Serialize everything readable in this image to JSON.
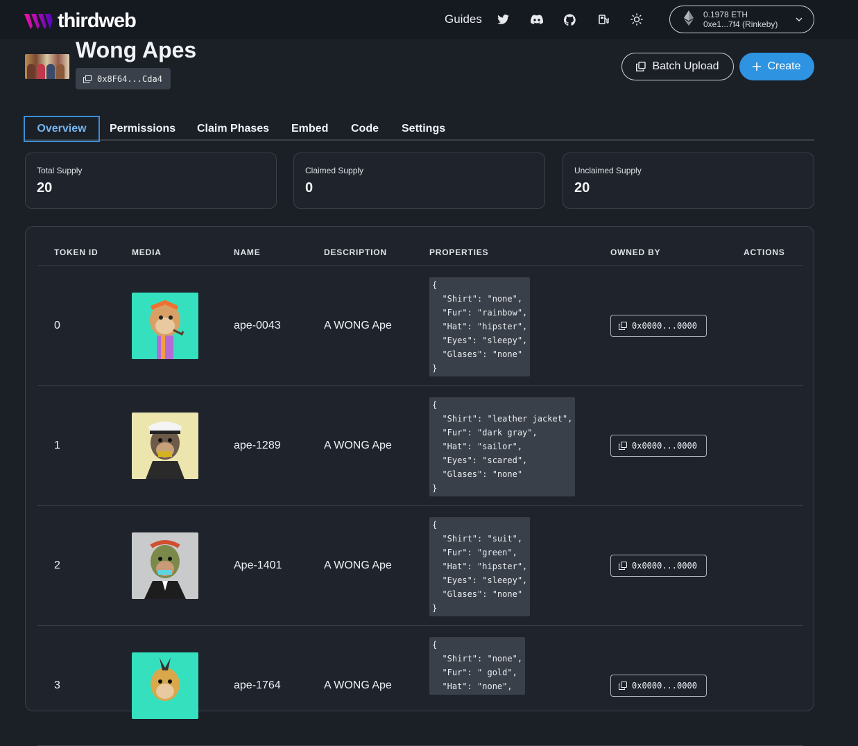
{
  "header": {
    "brand": "thirdweb",
    "nav": {
      "guides": "Guides"
    },
    "wallet": {
      "balance": "0.1978 ETH",
      "address": "0xe1...7f4 (Rinkeby)"
    }
  },
  "collection": {
    "title": "Wong Apes",
    "contract_address": "0x8F64...Cda4",
    "batch_upload_label": "Batch Upload",
    "create_label": "Create"
  },
  "tabs": [
    {
      "label": "Overview",
      "active": true
    },
    {
      "label": "Permissions"
    },
    {
      "label": "Claim Phases"
    },
    {
      "label": "Embed"
    },
    {
      "label": "Code"
    },
    {
      "label": "Settings"
    }
  ],
  "stats": [
    {
      "label": "Total Supply",
      "value": "20"
    },
    {
      "label": "Claimed Supply",
      "value": "0"
    },
    {
      "label": "Unclaimed Supply",
      "value": "20"
    }
  ],
  "table": {
    "columns": [
      "TOKEN ID",
      "MEDIA",
      "NAME",
      "DESCRIPTION",
      "PROPERTIES",
      "OWNED BY",
      "ACTIONS"
    ],
    "rows": [
      {
        "token_id": "0",
        "name": "ape-0043",
        "description": "A WONG Ape",
        "media_bg": "#35e0bf",
        "properties": "{\n  \"Shirt\": \"none\",\n  \"Fur\": \"rainbow\",\n  \"Hat\": \"hipster\",\n  \"Eyes\": \"sleepy\",\n  \"Glases\": \"none\"\n}",
        "owner": "0x0000...0000"
      },
      {
        "token_id": "1",
        "name": "ape-1289",
        "description": "A WONG Ape",
        "media_bg": "#ece6ae",
        "properties": "{\n  \"Shirt\": \"leather jacket\",\n  \"Fur\": \"dark gray\",\n  \"Hat\": \"sailor\",\n  \"Eyes\": \"scared\",\n  \"Glases\": \"none\"\n}",
        "owner": "0x0000...0000"
      },
      {
        "token_id": "2",
        "name": "Ape-1401",
        "description": "A WONG Ape",
        "media_bg": "#c9cacb",
        "properties": "{\n  \"Shirt\": \"suit\",\n  \"Fur\": \"green\",\n  \"Hat\": \"hipster\",\n  \"Eyes\": \"sleepy\",\n  \"Glases\": \"none\"\n}",
        "owner": "0x0000...0000"
      },
      {
        "token_id": "3",
        "name": "ape-1764",
        "description": "A WONG Ape",
        "media_bg": "#35e0bf",
        "properties": "{\n  \"Shirt\": \"none\",\n  \"Fur\": \" gold\",\n  \"Hat\": \"none\",",
        "owner": "0x0000...0000"
      }
    ]
  }
}
